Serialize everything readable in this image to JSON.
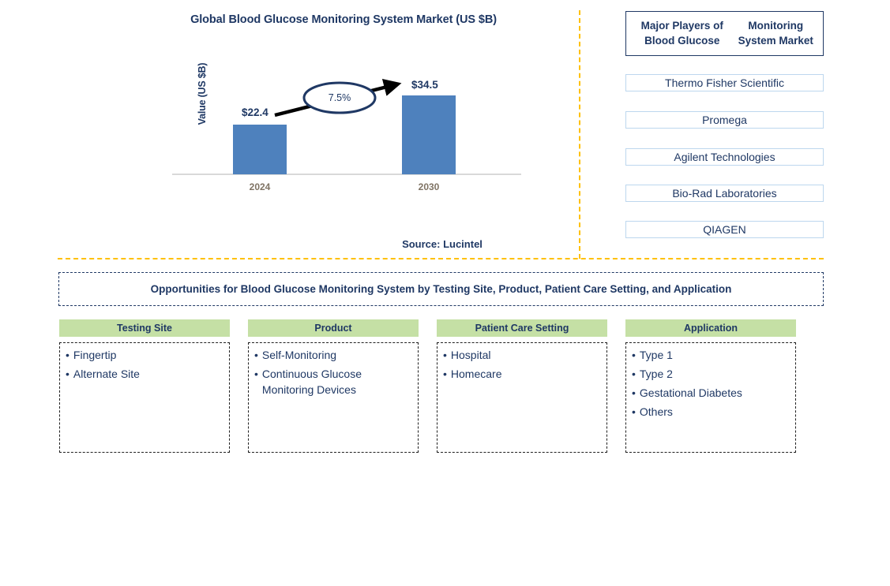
{
  "chart_data": {
    "type": "bar",
    "title": "Global Blood Glucose Monitoring System Market (US $B)",
    "xlabel": "",
    "ylabel": "Value (US $B)",
    "categories": [
      "2024",
      "2030"
    ],
    "values": [
      22.4,
      34.5
    ],
    "value_labels": [
      "$22.4",
      "$34.5"
    ],
    "ylim": [
      0,
      38
    ],
    "grid": false,
    "legend": "none",
    "annotation": "7.5%",
    "annotation_meaning": "CAGR growth arrow from 2024 to 2030",
    "bar_color": "#4E81BD",
    "source": "Source: Lucintel"
  },
  "chart": {
    "title": "Global Blood Glucose Monitoring System Market (US $B)",
    "y_axis_label": "Value (US $B)",
    "bars": [
      {
        "category": "2024",
        "value_label": "$22.4"
      },
      {
        "category": "2030",
        "value_label": "$34.5"
      }
    ],
    "cagr_label": "7.5%",
    "source": "Source: Lucintel"
  },
  "players_panel": {
    "header": "Major Players of Blood Glucose Monitoring System Market",
    "header_line1": "Major Players of Blood Glucose",
    "header_line2": "Monitoring System Market",
    "items": [
      "Thermo Fisher Scientific",
      "Promega",
      "Agilent Technologies",
      "Bio-Rad Laboratories",
      "QIAGEN"
    ]
  },
  "opportunities": {
    "banner": "Opportunities for Blood Glucose Monitoring System by Testing Site, Product, Patient Care Setting, and Application",
    "columns": [
      {
        "title": "Testing Site",
        "items": [
          "Fingertip",
          "Alternate Site"
        ]
      },
      {
        "title": "Product",
        "items": [
          "Self-Monitoring",
          "Continuous Glucose Monitoring Devices"
        ]
      },
      {
        "title": "Patient Care Setting",
        "items": [
          "Hospital",
          "Homecare"
        ]
      },
      {
        "title": "Application",
        "items": [
          "Type 1",
          "Type 2",
          "Gestational Diabetes",
          "Others"
        ]
      }
    ]
  },
  "colors": {
    "navy": "#1F3864",
    "bar_blue": "#4E81BD",
    "green_header": "#C5E0A5",
    "gold_divider": "#FFC000",
    "tick_grey": "#7F7364",
    "player_border": "#BDD7EE"
  },
  "bullet_glyph": "•"
}
